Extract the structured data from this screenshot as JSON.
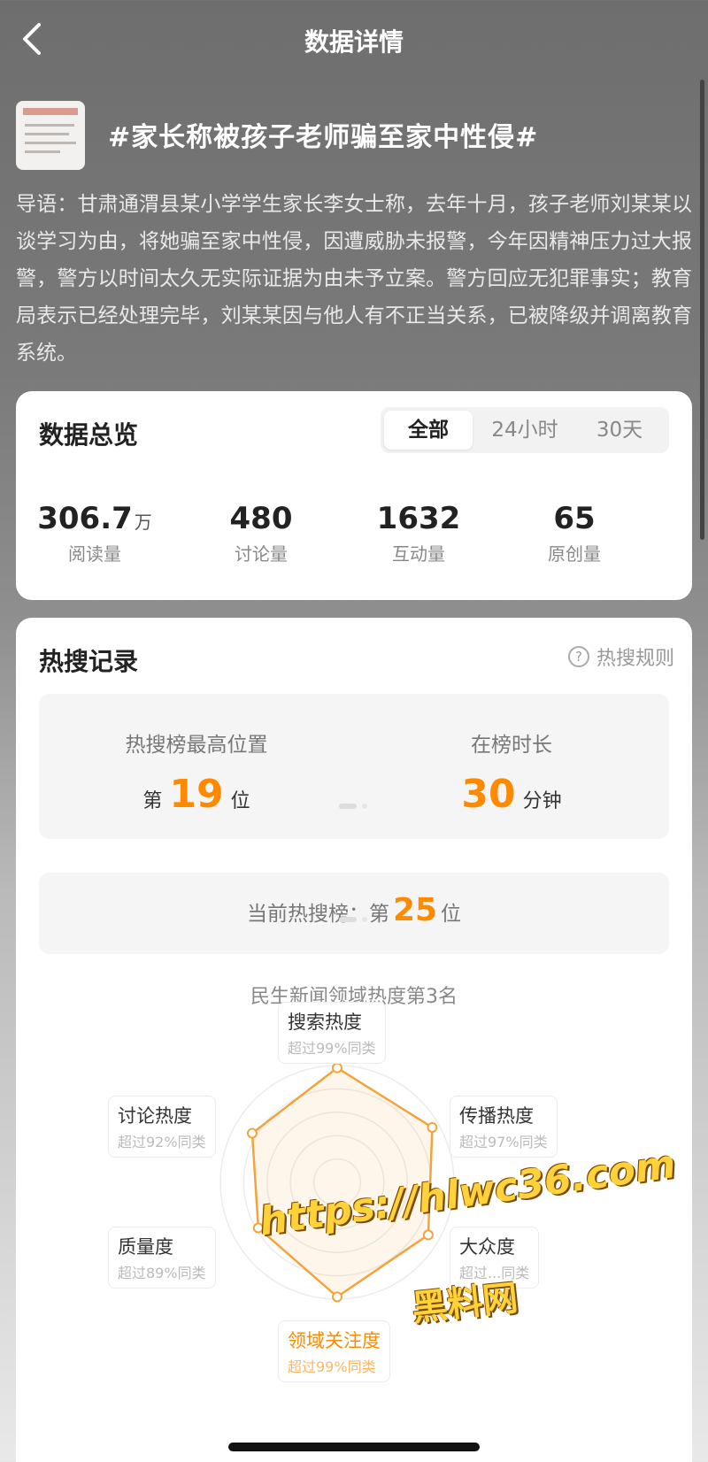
{
  "header": {
    "title": "数据详情"
  },
  "topic": {
    "title": "#家长称被孩子老师骗至家中性侵#",
    "summary": "导语：甘肃通渭县某小学学生家长李女士称，去年十月，孩子老师刘某某以谈学习为由，将她骗至家中性侵，因遭威胁未报警，今年因精神压力过大报警，警方以时间太久无实际证据为由未予立案。警方回应无犯罪事实；教育局表示已经处理完毕，刘某某因与他人有不正当关系，已被降级并调离教育系统。"
  },
  "overview": {
    "title": "数据总览",
    "tabs": [
      "全部",
      "24小时",
      "30天"
    ],
    "stats": [
      {
        "value": "306.7",
        "unit": "万",
        "label": "阅读量"
      },
      {
        "value": "480",
        "unit": "",
        "label": "讨论量"
      },
      {
        "value": "1632",
        "unit": "",
        "label": "互动量"
      },
      {
        "value": "65",
        "unit": "",
        "label": "原创量"
      }
    ]
  },
  "hot": {
    "title": "热搜记录",
    "rules": "热搜规则",
    "peak_caption": "热搜榜最高位置",
    "peak_prefix": "第",
    "peak_value": "19",
    "peak_suffix": "位",
    "duration_caption": "在榜时长",
    "duration_value": "30",
    "duration_unit": "分钟",
    "current_label": "当前热搜榜：第",
    "current_value": "25",
    "current_suffix": "位",
    "domain_rank": "民生新闻领域热度第3名"
  },
  "radar": {
    "axes": [
      {
        "name": "搜索热度",
        "sub": "超过99%同类",
        "pct": 99,
        "highlight": false
      },
      {
        "name": "传播热度",
        "sub": "超过97%同类",
        "pct": 97,
        "highlight": false
      },
      {
        "name": "大众度",
        "sub": "超过...同类",
        "pct": 95,
        "highlight": false
      },
      {
        "name": "领域关注度",
        "sub": "超过99%同类",
        "pct": 99,
        "highlight": true
      },
      {
        "name": "质量度",
        "sub": "超过89%同类",
        "pct": 89,
        "highlight": false
      },
      {
        "name": "讨论热度",
        "sub": "超过92%同类",
        "pct": 92,
        "highlight": false
      }
    ],
    "accent": "#f5a33c"
  },
  "watermark": {
    "line1": "https://hlwc36.com",
    "line2": "黑料网"
  }
}
